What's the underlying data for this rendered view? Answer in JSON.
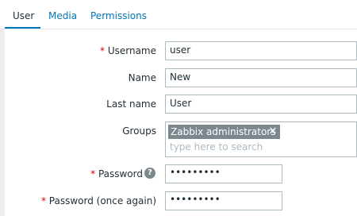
{
  "tabs": [
    {
      "label": "User"
    },
    {
      "label": "Media"
    },
    {
      "label": "Permissions"
    }
  ],
  "form": {
    "required_mark": "*",
    "username": {
      "label": "Username",
      "value": "user"
    },
    "name": {
      "label": "Name",
      "value": "New"
    },
    "last_name": {
      "label": "Last name",
      "value": "User"
    },
    "groups": {
      "label": "Groups",
      "selected": [
        "Zabbix administrators"
      ],
      "remove_glyph": "✕",
      "placeholder": "type here to search"
    },
    "password": {
      "label": "Password",
      "value": "•••••••••",
      "help_glyph": "?"
    },
    "password_again": {
      "label": "Password (once again)",
      "value": "•••••••••"
    }
  },
  "colors": {
    "accent": "#0275b8",
    "required": "#d40000",
    "chip": "#7c878e",
    "background": "#ebeef0"
  }
}
